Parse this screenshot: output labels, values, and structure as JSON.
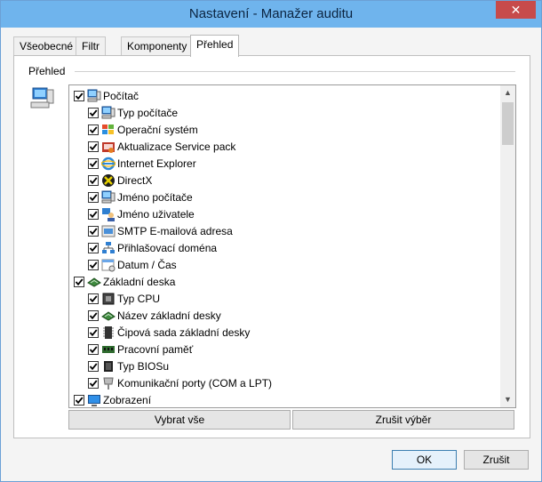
{
  "window": {
    "title": "Nastavení - Manažer auditu",
    "close_glyph": "✕"
  },
  "tabs": [
    {
      "label": "Všeobecné",
      "active": false
    },
    {
      "label": "Filtr",
      "active": false
    },
    {
      "label": "Komponenty",
      "active": false
    },
    {
      "label": "Přehled",
      "active": true
    }
  ],
  "group": {
    "label": "Přehled",
    "icon": "computer-icon"
  },
  "tree": [
    {
      "label": "Počítač",
      "level": 0,
      "checked": true,
      "icon": "computer-icon"
    },
    {
      "label": "Typ počítače",
      "level": 1,
      "checked": true,
      "icon": "computer-icon"
    },
    {
      "label": "Operační systém",
      "level": 1,
      "checked": true,
      "icon": "windows-logo-icon"
    },
    {
      "label": "Aktualizace Service pack",
      "level": 1,
      "checked": true,
      "icon": "update-icon"
    },
    {
      "label": "Internet Explorer",
      "level": 1,
      "checked": true,
      "icon": "internet-explorer-icon"
    },
    {
      "label": "DirectX",
      "level": 1,
      "checked": true,
      "icon": "directx-icon"
    },
    {
      "label": "Jméno počítače",
      "level": 1,
      "checked": true,
      "icon": "computer-icon"
    },
    {
      "label": "Jméno uživatele",
      "level": 1,
      "checked": true,
      "icon": "user-icon"
    },
    {
      "label": "SMTP E-mailová adresa",
      "level": 1,
      "checked": true,
      "icon": "email-icon"
    },
    {
      "label": "Přihlašovací doména",
      "level": 1,
      "checked": true,
      "icon": "network-icon"
    },
    {
      "label": "Datum / Čas",
      "level": 1,
      "checked": true,
      "icon": "calendar-icon"
    },
    {
      "label": "Základní deska",
      "level": 0,
      "checked": true,
      "icon": "motherboard-icon"
    },
    {
      "label": "Typ CPU",
      "level": 1,
      "checked": true,
      "icon": "cpu-icon"
    },
    {
      "label": "Název základní desky",
      "level": 1,
      "checked": true,
      "icon": "motherboard-icon"
    },
    {
      "label": "Čipová sada základní desky",
      "level": 1,
      "checked": true,
      "icon": "chipset-icon"
    },
    {
      "label": "Pracovní paměť",
      "level": 1,
      "checked": true,
      "icon": "memory-icon"
    },
    {
      "label": "Typ BIOSu",
      "level": 1,
      "checked": true,
      "icon": "bios-icon"
    },
    {
      "label": "Komunikační porty (COM a LPT)",
      "level": 1,
      "checked": true,
      "icon": "port-icon"
    },
    {
      "label": "Zobrazení",
      "level": 0,
      "checked": true,
      "icon": "display-icon"
    }
  ],
  "buttons": {
    "select_all": "Vybrat vše",
    "deselect": "Zrušit výběr",
    "ok": "OK",
    "cancel": "Zrušit"
  }
}
